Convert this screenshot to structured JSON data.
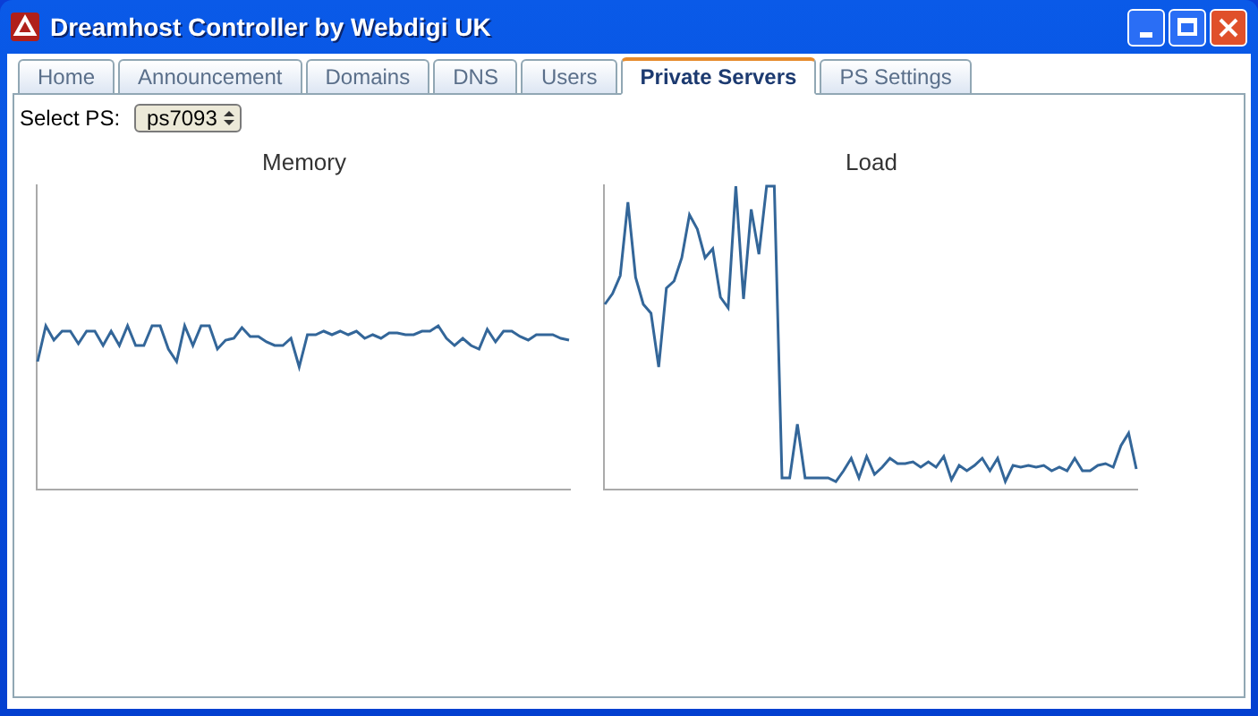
{
  "window": {
    "title": "Dreamhost Controller by Webdigi UK"
  },
  "tabs": [
    {
      "label": "Home",
      "selected": false
    },
    {
      "label": "Announcement",
      "selected": false
    },
    {
      "label": "Domains",
      "selected": false
    },
    {
      "label": "DNS",
      "selected": false
    },
    {
      "label": "Users",
      "selected": false
    },
    {
      "label": "Private Servers",
      "selected": true
    },
    {
      "label": "PS Settings",
      "selected": false
    }
  ],
  "select_ps": {
    "label": "Select PS:",
    "value": "ps7093"
  },
  "charts": [
    {
      "title": "Memory"
    },
    {
      "title": "Load"
    }
  ]
}
